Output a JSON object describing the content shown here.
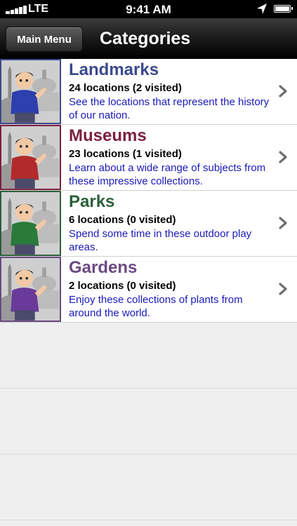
{
  "status_bar": {
    "carrier": "LTE",
    "time": "9:41 AM"
  },
  "nav": {
    "back_label": "Main Menu",
    "title": "Categories"
  },
  "categories": [
    {
      "title": "Landmarks",
      "count": "24 locations (2 visited)",
      "description": "See the locations that represent the history of our nation.",
      "color": "#3b4a8c",
      "shirt": "#2e3fae"
    },
    {
      "title": "Museums",
      "count": "23 locations (1 visited)",
      "description": "Learn about a wide range of subjects from these impressive collections.",
      "color": "#7d1f3f",
      "shirt": "#b22a2a"
    },
    {
      "title": "Parks",
      "count": "6 locations (0 visited)",
      "description": "Spend some time in these outdoor play areas.",
      "color": "#2c5f3a",
      "shirt": "#2a7a3a"
    },
    {
      "title": "Gardens",
      "count": "2 locations (0 visited)",
      "description": "Enjoy these collections of plants from around the world.",
      "color": "#6b4a82",
      "shirt": "#6a3a9a"
    }
  ]
}
